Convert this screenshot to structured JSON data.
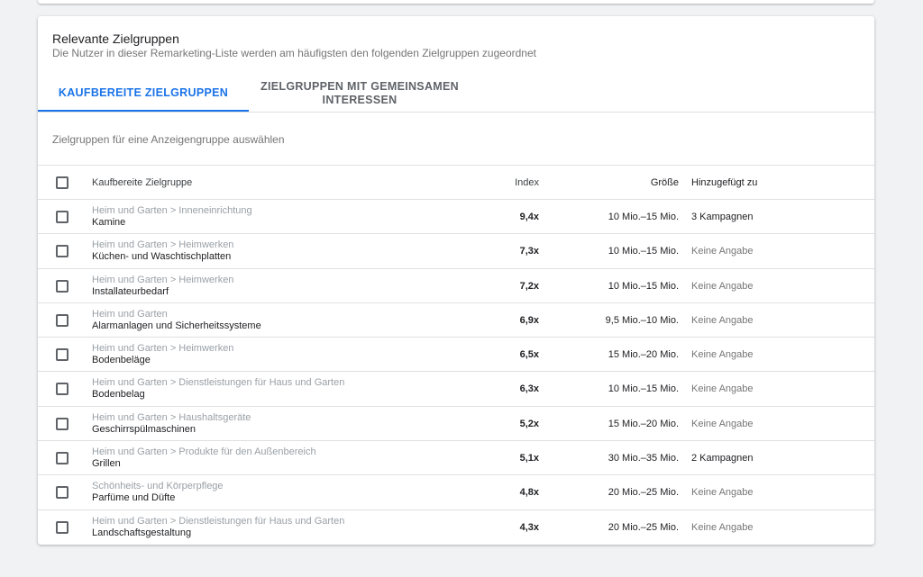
{
  "card": {
    "title": "Relevante Zielgruppen",
    "subtitle": "Die Nutzer in dieser Remarketing-Liste werden am häufigsten den folgenden Zielgruppen zugeordnet"
  },
  "tabs": [
    {
      "label": "KAUFBEREITE ZIELGRUPPEN",
      "active": true
    },
    {
      "label": "ZIELGRUPPEN MIT GEMEINSAMEN INTERESSEN",
      "active": false
    }
  ],
  "select_hint": "Zielgruppen für eine Anzeigengruppe auswählen",
  "table": {
    "headers": {
      "name": "Kaufbereite Zielgruppe",
      "index": "Index",
      "size": "Größe",
      "added": "Hinzugefügt zu"
    },
    "rows": [
      {
        "category": "Heim und Garten > Inneneinrichtung",
        "name": "Kamine",
        "index": "9,4x",
        "size": "10 Mio.–15 Mio.",
        "added": "3 Kampagnen",
        "muted": false
      },
      {
        "category": "Heim und Garten > Heimwerken",
        "name": "Küchen- und Waschtischplatten",
        "index": "7,3x",
        "size": "10 Mio.–15 Mio.",
        "added": "Keine Angabe",
        "muted": true
      },
      {
        "category": "Heim und Garten > Heimwerken",
        "name": "Installateurbedarf",
        "index": "7,2x",
        "size": "10 Mio.–15 Mio.",
        "added": "Keine Angabe",
        "muted": true
      },
      {
        "category": "Heim und Garten",
        "name": "Alarmanlagen und Sicherheitssysteme",
        "index": "6,9x",
        "size": "9,5 Mio.–10 Mio.",
        "added": "Keine Angabe",
        "muted": true
      },
      {
        "category": "Heim und Garten > Heimwerken",
        "name": "Bodenbeläge",
        "index": "6,5x",
        "size": "15 Mio.–20 Mio.",
        "added": "Keine Angabe",
        "muted": true
      },
      {
        "category": "Heim und Garten > Dienstleistungen für Haus und Garten",
        "name": "Bodenbelag",
        "index": "6,3x",
        "size": "10 Mio.–15 Mio.",
        "added": "Keine Angabe",
        "muted": true
      },
      {
        "category": "Heim und Garten > Haushaltsgeräte",
        "name": "Geschirrspülmaschinen",
        "index": "5,2x",
        "size": "15 Mio.–20 Mio.",
        "added": "Keine Angabe",
        "muted": true
      },
      {
        "category": "Heim und Garten > Produkte für den Außenbereich",
        "name": "Grillen",
        "index": "5,1x",
        "size": "30 Mio.–35 Mio.",
        "added": "2 Kampagnen",
        "muted": false
      },
      {
        "category": "Schönheits- und Körperpflege",
        "name": "Parfüme und Düfte",
        "index": "4,8x",
        "size": "20 Mio.–25 Mio.",
        "added": "Keine Angabe",
        "muted": true
      },
      {
        "category": "Heim und Garten > Dienstleistungen für Haus und Garten",
        "name": "Landschaftsgestaltung",
        "index": "4,3x",
        "size": "20 Mio.–25 Mio.",
        "added": "Keine Angabe",
        "muted": true
      }
    ]
  },
  "colors": {
    "accent": "#1a73e8",
    "background": "#f1f2f4"
  }
}
